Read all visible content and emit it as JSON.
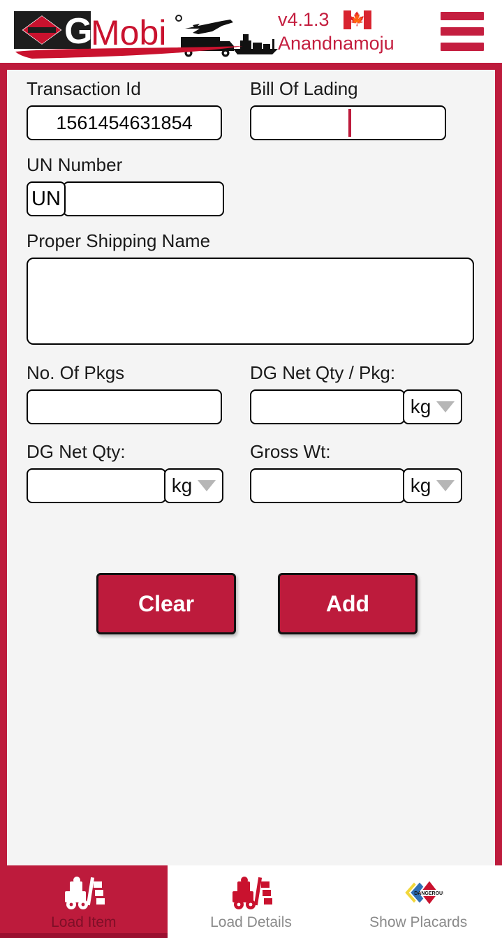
{
  "header": {
    "logo_text_dg": "DG",
    "logo_text_mobi": "Mobi",
    "version": "v4.1.3",
    "username": "Anandnamoju",
    "flag_name": "canada-flag",
    "menu_name": "hamburger-menu"
  },
  "form": {
    "transaction_id": {
      "label": "Transaction Id",
      "value": "1561454631854",
      "placeholder": ""
    },
    "bill_of_lading": {
      "label": "Bill Of Lading",
      "value": "",
      "placeholder": ""
    },
    "un_number": {
      "label": "UN Number",
      "prefix": "UN",
      "value": "",
      "placeholder": ""
    },
    "proper_shipping_name": {
      "label": "Proper Shipping Name",
      "value": "",
      "placeholder": ""
    },
    "no_of_pkgs": {
      "label": "No. Of Pkgs",
      "value": "",
      "placeholder": ""
    },
    "dg_net_qty_per_pkg": {
      "label": "DG Net Qty / Pkg:",
      "value": "",
      "placeholder": "",
      "unit": "kg"
    },
    "dg_net_qty": {
      "label": "DG Net Qty:",
      "value": "",
      "placeholder": "",
      "unit": "kg"
    },
    "gross_wt": {
      "label": "Gross Wt:",
      "value": "",
      "placeholder": "",
      "unit": "kg"
    }
  },
  "actions": {
    "clear_label": "Clear",
    "add_label": "Add"
  },
  "bottom_nav": {
    "tabs": [
      {
        "label": "Load Item",
        "icon": "forklift-icon",
        "active": true
      },
      {
        "label": "Load Details",
        "icon": "forklift-icon",
        "active": false
      },
      {
        "label": "Show Placards",
        "icon": "dangerous-placard-icon",
        "active": false
      }
    ]
  },
  "colors": {
    "brand_red": "#bd1b3c",
    "accent_red": "#c41e3f",
    "content_bg": "#f4f4f4",
    "caret_red": "#bd1b3c"
  }
}
